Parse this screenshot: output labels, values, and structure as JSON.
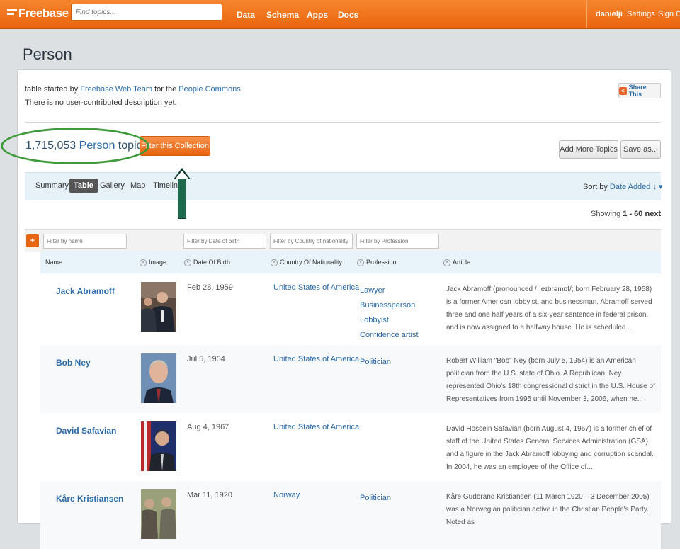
{
  "topbar": {
    "logo": "Freebase",
    "search_placeholder": "Find topics...",
    "nav": [
      "Data",
      "Schema",
      "Apps",
      "Docs"
    ],
    "user": "danielji",
    "settings": "Settings",
    "signout": "Sign Out"
  },
  "page": {
    "title": "Person",
    "meta_prefix": "table started by",
    "meta_author": "Freebase Web Team",
    "meta_mid": "for the",
    "meta_commons": "People Commons",
    "meta_desc": "There is no user-contributed description yet.",
    "share": "Share This",
    "count": "1,715,053",
    "type": "Person",
    "topics_word": "topics",
    "filter_collection": "Filter this Collection",
    "add_more": "Add More Topics",
    "save_as": "Save as..."
  },
  "viewbar": {
    "tabs": [
      "Summary",
      "Table",
      "Gallery",
      "Map",
      "Timeline"
    ],
    "active_tab": "Table",
    "sort_label": "Sort by",
    "sort_value": "Date Added",
    "showing_prefix": "Showing",
    "showing_range": "1 - 60",
    "next": "next"
  },
  "table": {
    "filters": [
      "Filter by name",
      "Filter by Date of birth",
      "Filter by Country of nationality",
      "Filter by Profession"
    ],
    "columns": [
      "Name",
      "Image",
      "Date Of Birth",
      "Country Of Nationality",
      "Profession",
      "Article"
    ],
    "rows": [
      {
        "name": "Jack Abramoff",
        "dob": "Feb 28, 1959",
        "country": "United States of America",
        "professions": [
          "Lawyer",
          "Businessperson",
          "Lobbyist",
          "Confidence artist"
        ],
        "article": "Jack Abramoff (pronounced / ˈeɪbrəmɒf/; born February 28, 1958) is a former American lobbyist, and businessman. Abramoff served three and one half years of a six-year sentence in federal prison, and is now assigned to a halfway house. He is scheduled..."
      },
      {
        "name": "Bob Ney",
        "dob": "Jul 5, 1954",
        "country": "United States of America",
        "professions": [
          "Politician"
        ],
        "article": "Robert William \"Bob\" Ney (born July 5, 1954) is an American politician from the U.S. state of Ohio. A Republican, Ney represented Ohio's 18th congressional district in the U.S. House of Representatives from 1995 until November 3, 2006, when he..."
      },
      {
        "name": "David Safavian",
        "dob": "Aug 4, 1967",
        "country": "United States of America",
        "professions": [],
        "article": "David Hossein Safavian (born August 4, 1967) is a former chief of staff of the United States General Services Administration (GSA) and a figure in the Jack Abramoff lobbying and corruption scandal. In 2004, he was an employee of the Office of..."
      },
      {
        "name": "Kåre Kristiansen",
        "dob": "Mar 11, 1920",
        "country": "Norway",
        "professions": [
          "Politician"
        ],
        "article": "Kåre Gudbrand Kristiansen (11 March 1920 – 3 December 2005) was a Norwegian politician active in the Christian People's Party. Noted as"
      }
    ]
  }
}
